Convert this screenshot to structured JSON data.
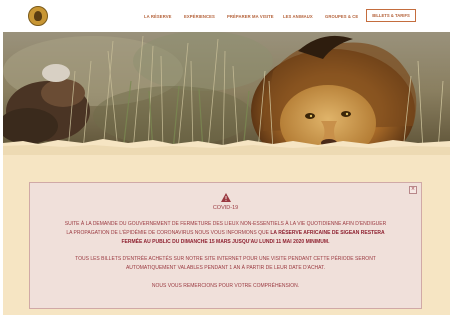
{
  "nav": {
    "items": [
      "LA RÉSERVE",
      "EXPÉRIENCES",
      "PRÉPARER MA VISITE",
      "LES ANIMAUX",
      "GROUPES & CE"
    ],
    "cta": "BILLETS & TARIFS"
  },
  "logo": {
    "icon": "lion-head-logo-icon"
  },
  "hero": {
    "image": "lion-in-grass-photo"
  },
  "alert": {
    "title": "COVID-19",
    "icon": "warning-triangle-icon",
    "close_icon": "close-icon",
    "line1": "SUITE À LA DEMANDE DU GOUVERNEMENT DE FERMETURE DES LIEUX NON-ESSENTIELS À LA VIE QUOTIDIENNE AFIN D'ENDIGUER",
    "line2_part1": "LA PROPAGATION DE L'ÉPIDÉMIE DE CORONAVIRUS NOUS VOUS INFORMONS QUE ",
    "line2_strong": "LA RÉSERVE AFRICAINE DE SIGEAN RESTERA",
    "line3_strong": "FERMÉE AU PUBLIC DU DIMANCHE 15 MARS JUSQU'AU LUNDI 11 MAI 2020 MINIMUM.",
    "line4": "TOUS LES BILLETS D'ENTRÉE ACHETÉS SUR NOTRE SITE INTERNET POUR UNE VISITE PENDANT CETTE PÉRIODE SERONT",
    "line5": "AUTOMATIQUEMENT VALABLES PENDANT 1 AN À PARTIR DE LEUR DATE D'ACHAT.",
    "line6": "NOUS VOUS REMERCIONS POUR VOTRE COMPRÉHENSION."
  },
  "colors": {
    "accent": "#b4623a",
    "alert_text": "#9a3940",
    "alert_bg": "#f0e0da",
    "page_bg": "#f6e5c3"
  }
}
